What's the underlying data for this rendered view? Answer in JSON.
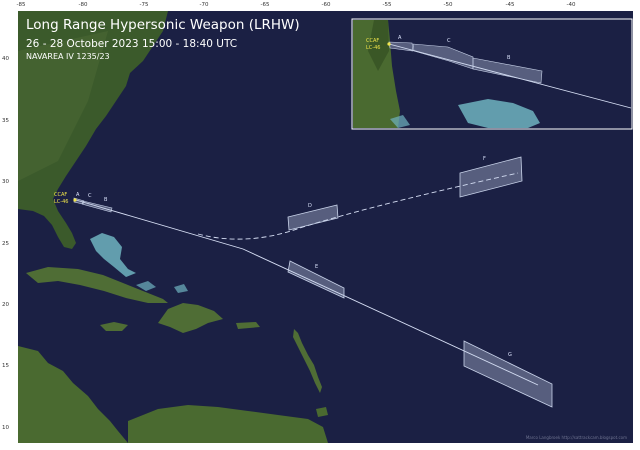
{
  "title": "Long Range Hypersonic Weapon (LRHW)",
  "subtitle": "26 - 28 October 2023   15:00 - 18:40 UTC",
  "notice": "NAVAREA IV 1235/23",
  "credit": "Marco Langbroek    http://sattrackcam.blogspot.com",
  "axes": {
    "x_ticks": [
      "-85",
      "-80",
      "-75",
      "-70",
      "-65",
      "-60",
      "-55",
      "-50",
      "-45",
      "-40"
    ],
    "y_ticks": [
      "40",
      "35",
      "30",
      "25",
      "20",
      "15",
      "10"
    ]
  },
  "launch_site": {
    "line1": "CCAF",
    "line2": "LC-46"
  },
  "zones": [
    "A",
    "B",
    "C",
    "D",
    "E",
    "F",
    "G"
  ],
  "inset": {
    "launch_site": {
      "line1": "CCAF",
      "line2": "LC-46"
    },
    "zones": [
      "A",
      "C",
      "B"
    ]
  },
  "colors": {
    "ocean": "#1b2044",
    "zone_fill": "#c9d3ea",
    "track": "#d7dff5",
    "label_yellow": "#f1e64a",
    "land_green": "#3d5a2c"
  }
}
